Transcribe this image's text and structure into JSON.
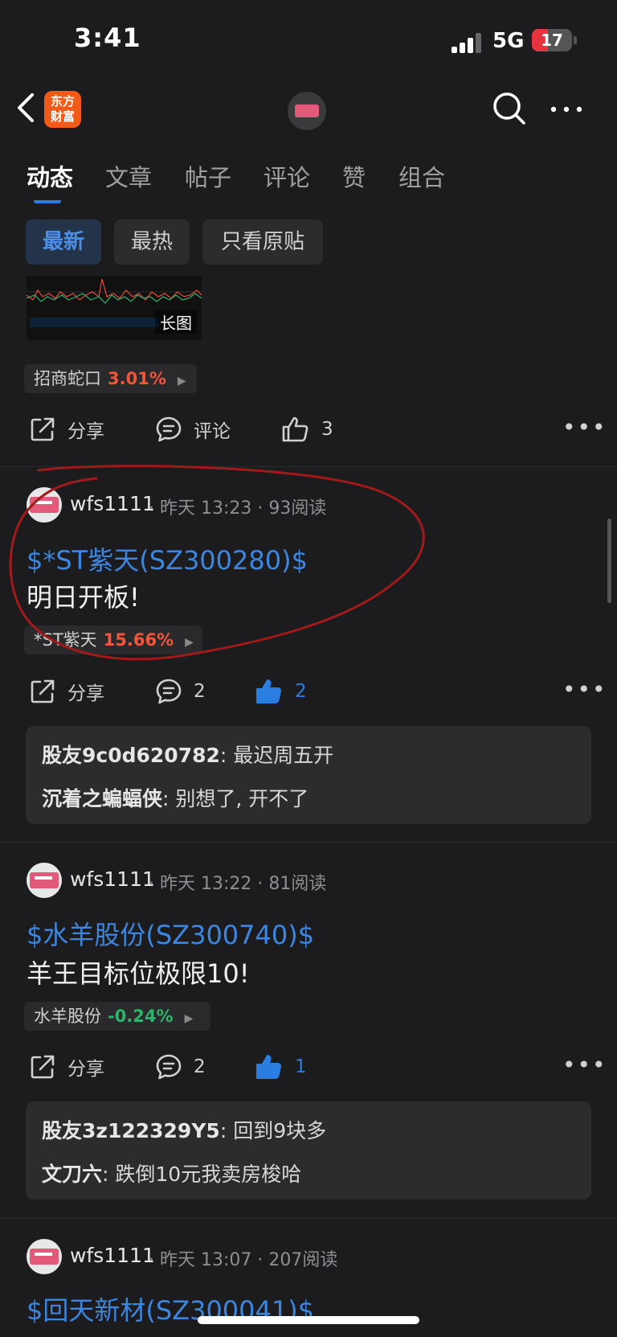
{
  "status": {
    "time": "3:41",
    "network": "5G",
    "battery": "17"
  },
  "nav": {
    "logo_text_line1": "东方",
    "logo_text_line2": "财富"
  },
  "tabs": [
    {
      "label": "动态"
    },
    {
      "label": "文章"
    },
    {
      "label": "帖子"
    },
    {
      "label": "评论"
    },
    {
      "label": "赞"
    },
    {
      "label": "组合"
    }
  ],
  "filters": [
    {
      "label": "最新"
    },
    {
      "label": "最热"
    },
    {
      "label": "只看原贴"
    }
  ],
  "post0": {
    "thumb_label": "长图",
    "stock_tag": {
      "name": "招商蛇口",
      "change": "3.01%"
    },
    "actions": {
      "share": "分享",
      "comment": "评论",
      "likes": "3"
    }
  },
  "post1": {
    "author": "wfs1111",
    "time": "昨天 13:23",
    "reads": "93阅读",
    "stock_link": "$*ST紫天(SZ300280)$",
    "text": "明日开板!",
    "stock_tag": {
      "name": "*ST紫天",
      "change": "15.66%"
    },
    "actions": {
      "share": "分享",
      "comments": "2",
      "likes": "2"
    },
    "comments": [
      {
        "name": "股友9c0d620782",
        "text": "最迟周五开"
      },
      {
        "name": "沉着之蝙蝠侠",
        "text": "别想了, 开不了"
      }
    ]
  },
  "post2": {
    "author": "wfs1111",
    "time": "昨天 13:22",
    "reads": "81阅读",
    "stock_link": "$水羊股份(SZ300740)$",
    "text": "羊王目标位极限10!",
    "stock_tag": {
      "name": "水羊股份",
      "change": "-0.24%"
    },
    "actions": {
      "share": "分享",
      "comments": "2",
      "likes": "1"
    },
    "comments": [
      {
        "name": "股友3z122329Y5",
        "text": "回到9块多"
      },
      {
        "name": "文刀六",
        "text": "跌倒10元我卖房梭哈"
      }
    ]
  },
  "post3": {
    "author": "wfs1111",
    "time": "昨天 13:07",
    "reads": "207阅读",
    "stock_link": "$回天新材(SZ300041)$"
  },
  "colors": {
    "accent": "#3d86e0",
    "up": "#f2553c",
    "down": "#2fb36a",
    "annotation": "#a11a1a"
  }
}
